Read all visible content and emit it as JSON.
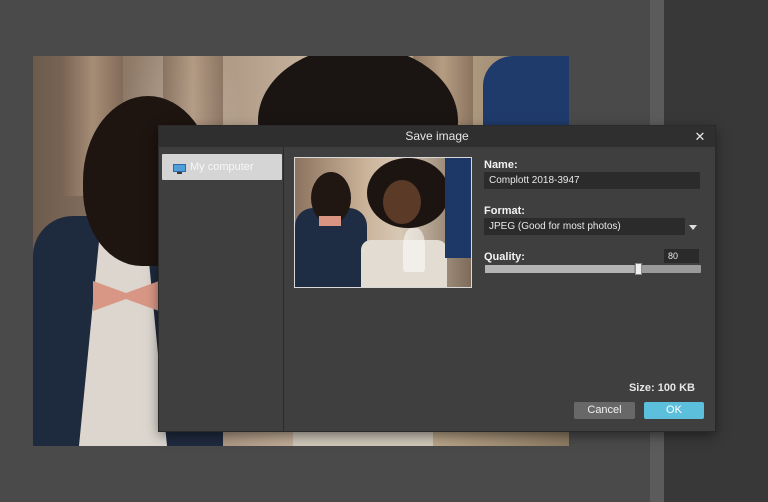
{
  "dialog": {
    "title": "Save image",
    "close_icon": "close-icon"
  },
  "sidebar": {
    "items": [
      {
        "label": "My computer",
        "icon": "monitor-icon",
        "selected": true
      }
    ]
  },
  "form": {
    "name_label": "Name:",
    "name_value": "Complott 2018-3947",
    "format_label": "Format:",
    "format_value": "JPEG (Good for most photos)",
    "quality_label": "Quality:",
    "quality_value": "80",
    "quality_level": 80,
    "quality_max": 100
  },
  "footer": {
    "size_text": "Size: 100 KB",
    "cancel_label": "Cancel",
    "ok_label": "OK"
  },
  "colors": {
    "accent": "#5cc0dc",
    "dialog_bg": "#3f3f3f",
    "titlebar_bg": "#2f2f2f"
  }
}
